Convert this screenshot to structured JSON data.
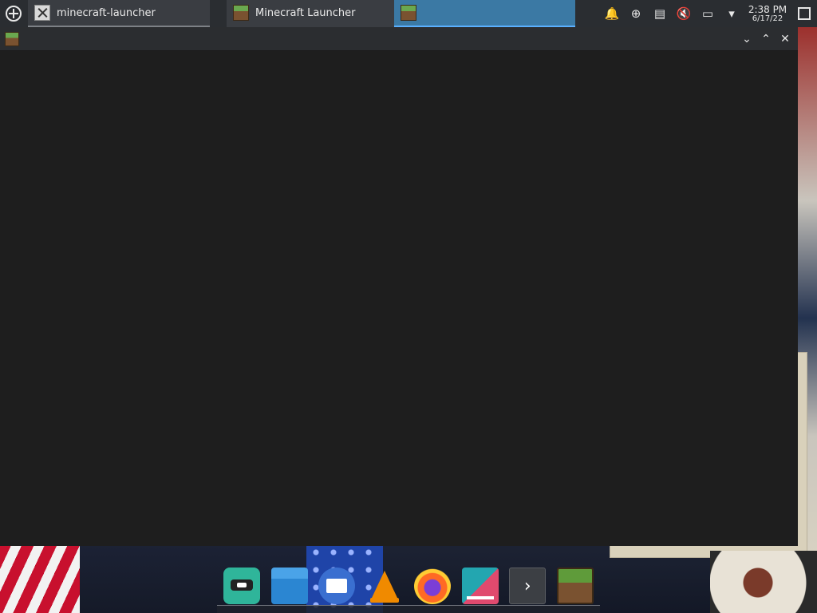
{
  "taskbar": {
    "tasks": [
      {
        "label": "minecraft-launcher",
        "icon": "x-window-icon"
      },
      {
        "label": "Minecraft Launcher",
        "icon": "minecraft-grass-icon"
      },
      {
        "label": "",
        "icon": "minecraft-grass-icon",
        "active": true
      }
    ],
    "tray": {
      "icons": [
        "notifications-icon",
        "updates-icon",
        "clipboard-icon",
        "volume-muted-icon",
        "display-icon",
        "expand-tray-icon"
      ],
      "time": "2:38 PM",
      "date": "6/17/22"
    }
  },
  "window": {
    "title": "",
    "icon": "minecraft-grass-icon",
    "controls": [
      "minimize-icon",
      "maximize-icon",
      "close-icon"
    ]
  },
  "dock": {
    "items": [
      {
        "name": "game-launcher"
      },
      {
        "name": "file-manager"
      },
      {
        "name": "mail-client"
      },
      {
        "name": "vlc-media-player"
      },
      {
        "name": "firefox"
      },
      {
        "name": "presentation-app"
      },
      {
        "name": "terminal"
      },
      {
        "name": "minecraft"
      }
    ]
  },
  "colors": {
    "panel": "#2a2d31",
    "active_task": "#3b79a4",
    "window_bg": "#1e1e1e"
  }
}
